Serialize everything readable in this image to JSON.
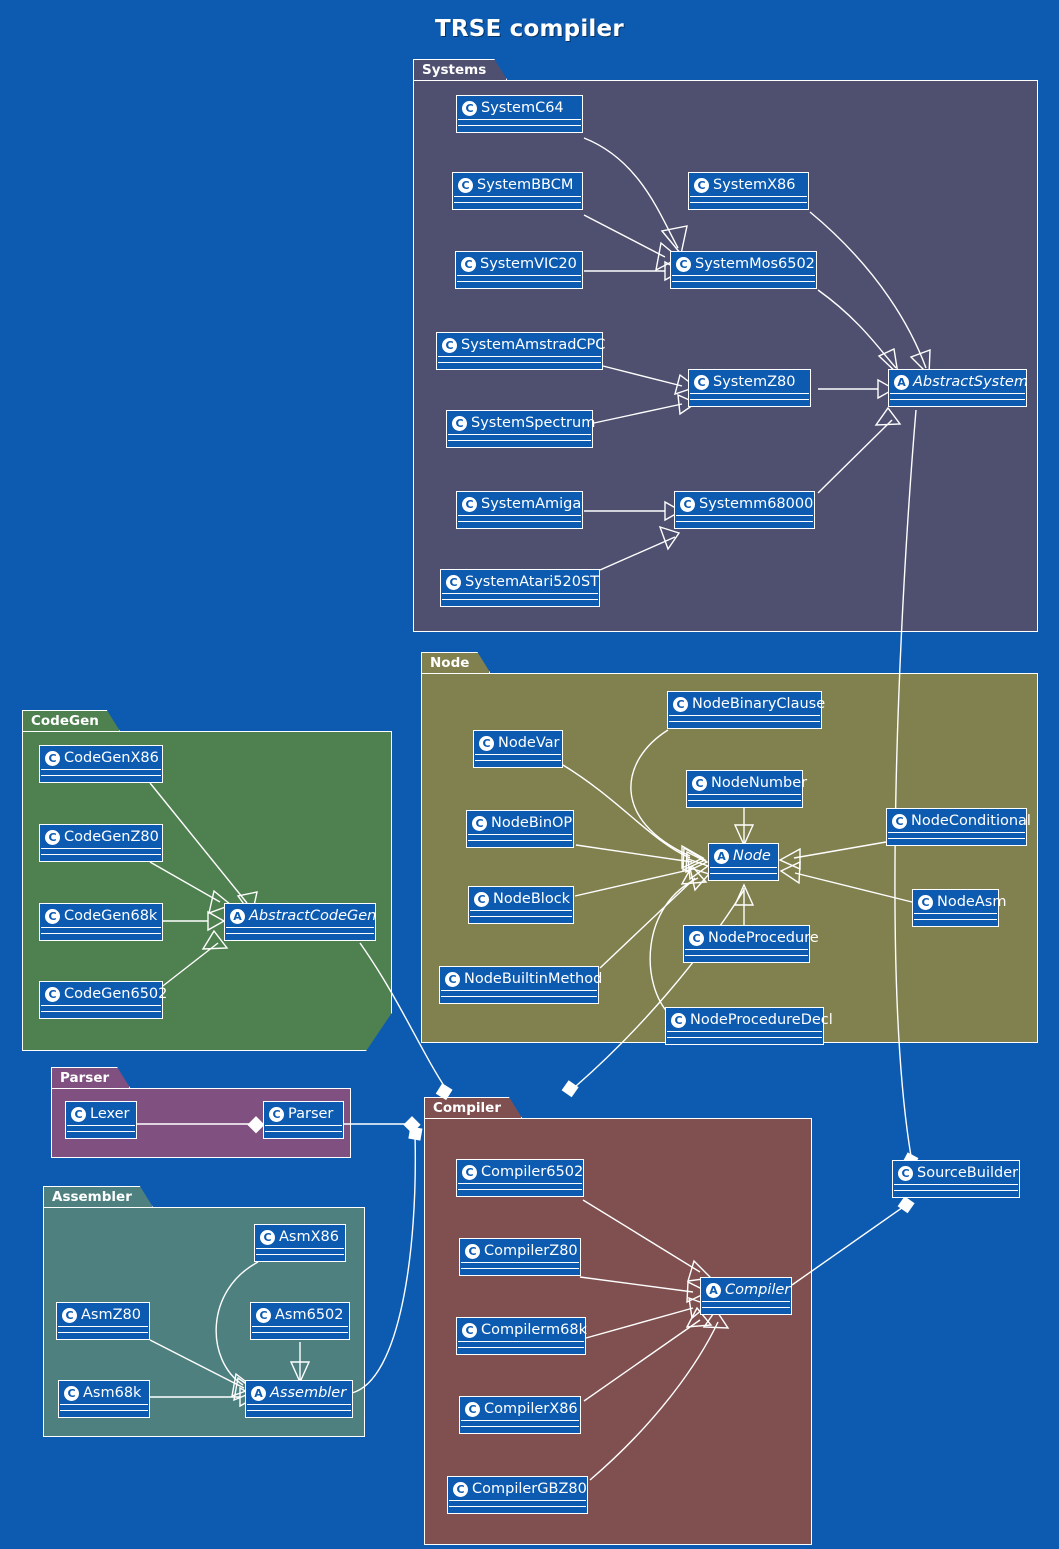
{
  "title": "TRSE compiler",
  "colors": {
    "background": "#0d5bb0",
    "class_fill": "#0d5bb0",
    "stroke": "#ffffff",
    "pkg_systems": "#4f4f70",
    "pkg_node": "#81804f",
    "pkg_codegen": "#4f8050",
    "pkg_parser": "#805080",
    "pkg_assembler": "#4f8080",
    "pkg_compiler": "#805050"
  },
  "packages": [
    {
      "id": "systems",
      "name": "Systems",
      "classes": [
        {
          "id": "SystemC64",
          "name": "SystemC64",
          "stereotype": "C",
          "abstract": false
        },
        {
          "id": "SystemBBCM",
          "name": "SystemBBCM",
          "stereotype": "C",
          "abstract": false
        },
        {
          "id": "SystemX86",
          "name": "SystemX86",
          "stereotype": "C",
          "abstract": false
        },
        {
          "id": "SystemVIC20",
          "name": "SystemVIC20",
          "stereotype": "C",
          "abstract": false
        },
        {
          "id": "SystemMos6502",
          "name": "SystemMos6502",
          "stereotype": "C",
          "abstract": false
        },
        {
          "id": "SystemAmstradCPC",
          "name": "SystemAmstradCPC",
          "stereotype": "C",
          "abstract": false
        },
        {
          "id": "SystemZ80",
          "name": "SystemZ80",
          "stereotype": "C",
          "abstract": false
        },
        {
          "id": "AbstractSystem",
          "name": "AbstractSystem",
          "stereotype": "A",
          "abstract": true
        },
        {
          "id": "SystemSpectrum",
          "name": "SystemSpectrum",
          "stereotype": "C",
          "abstract": false
        },
        {
          "id": "SystemAmiga",
          "name": "SystemAmiga",
          "stereotype": "C",
          "abstract": false
        },
        {
          "id": "Systemm68000",
          "name": "Systemm68000",
          "stereotype": "C",
          "abstract": false
        },
        {
          "id": "SystemAtari520ST",
          "name": "SystemAtari520ST",
          "stereotype": "C",
          "abstract": false
        }
      ]
    },
    {
      "id": "node",
      "name": "Node",
      "classes": [
        {
          "id": "NodeBinaryClause",
          "name": "NodeBinaryClause",
          "stereotype": "C",
          "abstract": false
        },
        {
          "id": "NodeVar",
          "name": "NodeVar",
          "stereotype": "C",
          "abstract": false
        },
        {
          "id": "NodeNumber",
          "name": "NodeNumber",
          "stereotype": "C",
          "abstract": false
        },
        {
          "id": "NodeBinOP",
          "name": "NodeBinOP",
          "stereotype": "C",
          "abstract": false
        },
        {
          "id": "NodeConditional",
          "name": "NodeConditional",
          "stereotype": "C",
          "abstract": false
        },
        {
          "id": "Node",
          "name": "Node",
          "stereotype": "A",
          "abstract": true
        },
        {
          "id": "NodeBlock",
          "name": "NodeBlock",
          "stereotype": "C",
          "abstract": false
        },
        {
          "id": "NodeAsm",
          "name": "NodeAsm",
          "stereotype": "C",
          "abstract": false
        },
        {
          "id": "NodeProcedure",
          "name": "NodeProcedure",
          "stereotype": "C",
          "abstract": false
        },
        {
          "id": "NodeBuiltinMethod",
          "name": "NodeBuiltinMethod",
          "stereotype": "C",
          "abstract": false
        },
        {
          "id": "NodeProcedureDecl",
          "name": "NodeProcedureDecl",
          "stereotype": "C",
          "abstract": false
        }
      ]
    },
    {
      "id": "codegen",
      "name": "CodeGen",
      "classes": [
        {
          "id": "CodeGenX86",
          "name": "CodeGenX86",
          "stereotype": "C",
          "abstract": false
        },
        {
          "id": "CodeGenZ80",
          "name": "CodeGenZ80",
          "stereotype": "C",
          "abstract": false
        },
        {
          "id": "CodeGen68k",
          "name": "CodeGen68k",
          "stereotype": "C",
          "abstract": false
        },
        {
          "id": "AbstractCodeGen",
          "name": "AbstractCodeGen",
          "stereotype": "A",
          "abstract": true
        },
        {
          "id": "CodeGen6502",
          "name": "CodeGen6502",
          "stereotype": "C",
          "abstract": false
        }
      ]
    },
    {
      "id": "parser",
      "name": "Parser",
      "classes": [
        {
          "id": "Lexer",
          "name": "Lexer",
          "stereotype": "C",
          "abstract": false
        },
        {
          "id": "Parser",
          "name": "Parser",
          "stereotype": "C",
          "abstract": false
        }
      ]
    },
    {
      "id": "assembler",
      "name": "Assembler",
      "classes": [
        {
          "id": "AsmX86",
          "name": "AsmX86",
          "stereotype": "C",
          "abstract": false
        },
        {
          "id": "AsmZ80",
          "name": "AsmZ80",
          "stereotype": "C",
          "abstract": false
        },
        {
          "id": "Asm6502",
          "name": "Asm6502",
          "stereotype": "C",
          "abstract": false
        },
        {
          "id": "Asm68k",
          "name": "Asm68k",
          "stereotype": "C",
          "abstract": false
        },
        {
          "id": "Assembler",
          "name": "Assembler",
          "stereotype": "A",
          "abstract": true
        }
      ]
    },
    {
      "id": "compiler",
      "name": "Compiler",
      "classes": [
        {
          "id": "Compiler6502",
          "name": "Compiler6502",
          "stereotype": "C",
          "abstract": false
        },
        {
          "id": "CompilerZ80",
          "name": "CompilerZ80",
          "stereotype": "C",
          "abstract": false
        },
        {
          "id": "Compiler",
          "name": "Compiler",
          "stereotype": "A",
          "abstract": true
        },
        {
          "id": "Compilerm68k",
          "name": "Compilerm68k",
          "stereotype": "C",
          "abstract": false
        },
        {
          "id": "CompilerX86",
          "name": "CompilerX86",
          "stereotype": "C",
          "abstract": false
        },
        {
          "id": "CompilerGBZ80",
          "name": "CompilerGBZ80",
          "stereotype": "C",
          "abstract": false
        }
      ]
    }
  ],
  "standalone_classes": [
    {
      "id": "SourceBuilder",
      "name": "SourceBuilder",
      "stereotype": "C",
      "abstract": false
    }
  ],
  "relations": [
    {
      "from": "SystemC64",
      "to": "SystemMos6502",
      "kind": "generalization"
    },
    {
      "from": "SystemBBCM",
      "to": "SystemMos6502",
      "kind": "generalization"
    },
    {
      "from": "SystemVIC20",
      "to": "SystemMos6502",
      "kind": "generalization"
    },
    {
      "from": "SystemMos6502",
      "to": "AbstractSystem",
      "kind": "generalization"
    },
    {
      "from": "SystemX86",
      "to": "AbstractSystem",
      "kind": "generalization"
    },
    {
      "from": "SystemAmstradCPC",
      "to": "SystemZ80",
      "kind": "generalization"
    },
    {
      "from": "SystemSpectrum",
      "to": "SystemZ80",
      "kind": "generalization"
    },
    {
      "from": "SystemZ80",
      "to": "AbstractSystem",
      "kind": "generalization"
    },
    {
      "from": "SystemAmiga",
      "to": "Systemm68000",
      "kind": "generalization"
    },
    {
      "from": "SystemAtari520ST",
      "to": "Systemm68000",
      "kind": "generalization"
    },
    {
      "from": "Systemm68000",
      "to": "AbstractSystem",
      "kind": "generalization"
    },
    {
      "from": "AbstractSystem",
      "to": "SourceBuilder",
      "kind": "association"
    },
    {
      "from": "NodeVar",
      "to": "Node",
      "kind": "generalization"
    },
    {
      "from": "NodeBinaryClause",
      "to": "Node",
      "kind": "generalization"
    },
    {
      "from": "NodeNumber",
      "to": "Node",
      "kind": "generalization"
    },
    {
      "from": "NodeBinOP",
      "to": "Node",
      "kind": "generalization"
    },
    {
      "from": "NodeBlock",
      "to": "Node",
      "kind": "generalization"
    },
    {
      "from": "NodeBuiltinMethod",
      "to": "Node",
      "kind": "generalization"
    },
    {
      "from": "NodeProcedure",
      "to": "Node",
      "kind": "generalization"
    },
    {
      "from": "NodeProcedureDecl",
      "to": "Node",
      "kind": "generalization"
    },
    {
      "from": "NodeConditional",
      "to": "Node",
      "kind": "generalization"
    },
    {
      "from": "NodeAsm",
      "to": "Node",
      "kind": "generalization"
    },
    {
      "from": "Node",
      "to": "Compiler",
      "kind": "aggregation"
    },
    {
      "from": "CodeGenX86",
      "to": "AbstractCodeGen",
      "kind": "generalization"
    },
    {
      "from": "CodeGenZ80",
      "to": "AbstractCodeGen",
      "kind": "generalization"
    },
    {
      "from": "CodeGen68k",
      "to": "AbstractCodeGen",
      "kind": "generalization"
    },
    {
      "from": "CodeGen6502",
      "to": "AbstractCodeGen",
      "kind": "generalization"
    },
    {
      "from": "AbstractCodeGen",
      "to": "Compiler",
      "kind": "aggregation"
    },
    {
      "from": "Lexer",
      "to": "Parser",
      "kind": "aggregation"
    },
    {
      "from": "Parser",
      "to": "Compiler",
      "kind": "aggregation"
    },
    {
      "from": "AsmX86",
      "to": "Assembler",
      "kind": "generalization"
    },
    {
      "from": "AsmZ80",
      "to": "Assembler",
      "kind": "generalization"
    },
    {
      "from": "Asm6502",
      "to": "Assembler",
      "kind": "generalization"
    },
    {
      "from": "Asm68k",
      "to": "Assembler",
      "kind": "generalization"
    },
    {
      "from": "Assembler",
      "to": "Compiler",
      "kind": "aggregation"
    },
    {
      "from": "Compiler6502",
      "to": "Compiler",
      "kind": "generalization"
    },
    {
      "from": "CompilerZ80",
      "to": "Compiler",
      "kind": "generalization"
    },
    {
      "from": "Compilerm68k",
      "to": "Compiler",
      "kind": "generalization"
    },
    {
      "from": "CompilerX86",
      "to": "Compiler",
      "kind": "generalization"
    },
    {
      "from": "CompilerGBZ80",
      "to": "Compiler",
      "kind": "generalization"
    },
    {
      "from": "Compiler",
      "to": "SourceBuilder",
      "kind": "association"
    }
  ]
}
